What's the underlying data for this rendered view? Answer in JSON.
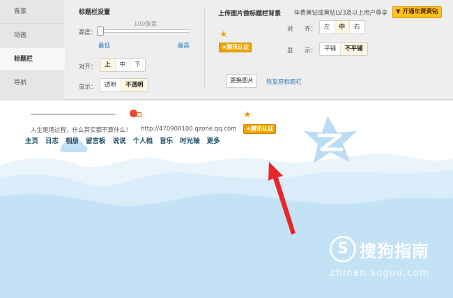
{
  "sidebar": {
    "items": [
      {
        "label": "背景"
      },
      {
        "label": "动画"
      },
      {
        "label": "标题栏"
      },
      {
        "label": "导航"
      }
    ]
  },
  "title_settings": {
    "heading": "标题栏设置",
    "height_label": "高度：",
    "height_value_text": "100像素",
    "min_label": "最低",
    "max_label": "最高",
    "height_level": 0.0,
    "align_label": "对齐：",
    "align_options": [
      "上",
      "中",
      "下"
    ],
    "align_selected": "上",
    "display_label": "显示：",
    "display_options": [
      "透明",
      "不透明"
    ],
    "display_selected": "不透明"
  },
  "upload": {
    "heading": "上传图片做标题栏背景",
    "vip_note": "年费黄钻或黄钻LV3及以上用户尊享",
    "vip_button": "开通年费黄钻",
    "align_label_1": "对",
    "align_label_2": "齐：",
    "align_options": [
      "左",
      "中",
      "右"
    ],
    "align_selected": "中",
    "display_label_1": "显",
    "display_label_2": "示：",
    "display_options": [
      "平铺",
      "不平铺"
    ],
    "display_selected": "不平铺",
    "badge_text": "腾讯认证",
    "change_image": "更换图片",
    "restore": "恢复原标题栏"
  },
  "preview": {
    "title_dashes": "———————————",
    "description": "人生是场过程，什么其实都不算什么！",
    "url": "http://470900100.qzone.qq.com",
    "badge_text": "腾讯认证",
    "nav": [
      "主页",
      "日志",
      "相册",
      "留言板",
      "说说",
      "个人档",
      "音乐",
      "时光轴",
      "更多"
    ]
  },
  "watermark": {
    "logo": "S",
    "name": "搜狗指南",
    "url": "zhinan.sogou.com"
  },
  "colors": {
    "accent_blue": "#2b7bc6",
    "vip_yellow": "#ffc21e",
    "sky": "#d3ebfa",
    "arrow_red": "#e8262a"
  }
}
